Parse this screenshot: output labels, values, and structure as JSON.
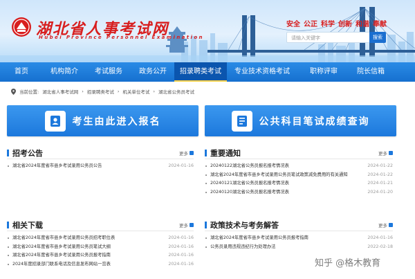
{
  "header": {
    "site_title": "湖北省人事考试网",
    "site_subtitle": "Hubei Province Personnel Examination",
    "slogan": [
      "安全",
      "公正",
      "科学",
      "创新",
      "和谐",
      "奉献"
    ],
    "search_placeholder": "请输入关键字",
    "search_button": "搜索"
  },
  "nav": [
    {
      "label": "首页",
      "active": false
    },
    {
      "label": "机构简介",
      "active": false
    },
    {
      "label": "考试服务",
      "active": false
    },
    {
      "label": "政务公开",
      "active": false
    },
    {
      "label": "招录聘类考试",
      "active": true
    },
    {
      "label": "专业技术资格考试",
      "active": false
    },
    {
      "label": "职称评审",
      "active": false
    },
    {
      "label": "院长信箱",
      "active": false
    }
  ],
  "breadcrumb": [
    "当前位置:",
    "湖北省人事考试网",
    "招录聘类考试",
    "机关单位考试",
    "湖北省公务员考试"
  ],
  "buttons": {
    "register": "考生由此进入报名",
    "score": "公共科目笔试成绩查询"
  },
  "sections": {
    "announce": {
      "title": "招考公告",
      "more": "更多",
      "items": [
        {
          "text": "湖北省2024年度省市县乡考试录用公务员公告",
          "date": "2024-01-16"
        }
      ]
    },
    "notice": {
      "title": "重要通知",
      "more": "更多",
      "items": [
        {
          "text": "20240122湖北省公务员报名报考情况表",
          "date": "2024-01-22"
        },
        {
          "text": "湖北省2024年度省市县乡考试录用公务员笔试政策减免费用的有关通知",
          "date": "2024-01-22"
        },
        {
          "text": "20240121湖北省公务员报名报考情况表",
          "date": "2024-01-21"
        },
        {
          "text": "20240120湖北省公务员报名报考情况表",
          "date": "2024-01-20"
        }
      ]
    },
    "download": {
      "title": "相关下载",
      "more": "更多",
      "items": [
        {
          "text": "湖北省2024年度省市县乡考试录用公务员招考职位表",
          "date": "2024-01-16"
        },
        {
          "text": "湖北省2024年度省市县乡考试录用公务员笔试大纲",
          "date": "2024-01-16"
        },
        {
          "text": "湖北省2024年度省市县乡考试录用公务员报考指南",
          "date": "2024-01-16"
        },
        {
          "text": "2024年度招录部门联系电话及信息发布网站一览表",
          "date": "2024-01-16"
        }
      ]
    },
    "policy": {
      "title": "政策技术与考务解答",
      "more": "更多",
      "items": [
        {
          "text": "湖北省2024年度省市县乡考试录用公务员报考指南",
          "date": "2024-01-16"
        },
        {
          "text": "公务员录用违规违纪行为处理办法",
          "date": "2022-02-18"
        }
      ]
    }
  },
  "watermark": "知乎 @格木教育",
  "colors": {
    "brand_red": "#d81e1e",
    "nav_blue": "#1670cf",
    "active_blue": "#0b55ae",
    "button_blue": "#1c78dc"
  }
}
